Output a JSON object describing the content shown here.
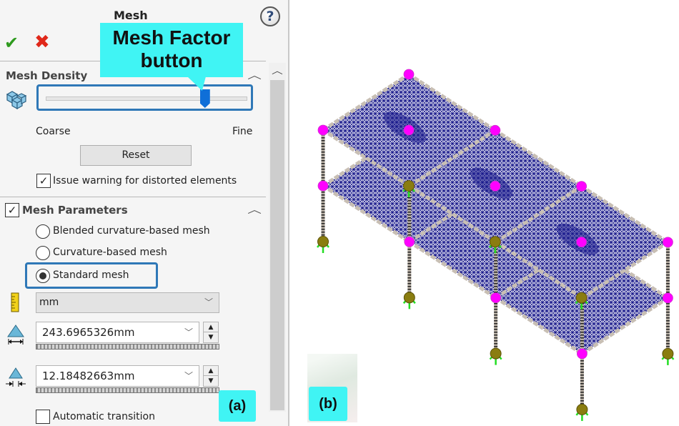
{
  "panel": {
    "title": "Mesh",
    "help_icon": "?",
    "ok_icon": "✔",
    "cancel_icon": "✖",
    "mesh_density": {
      "section_title": "Mesh Density",
      "slider_value_fraction": 0.79,
      "coarse_label": "Coarse",
      "fine_label": "Fine",
      "reset_label": "Reset",
      "warn_checkbox_label": "Issue warning for distorted elements",
      "warn_checked": true
    },
    "mesh_parameters": {
      "section_title": "Mesh Parameters",
      "enabled": true,
      "options": [
        {
          "label": "Blended curvature-based mesh",
          "selected": false
        },
        {
          "label": "Curvature-based mesh",
          "selected": false
        },
        {
          "label": "Standard mesh",
          "selected": true
        }
      ],
      "unit": "mm",
      "global_size": "243.6965326mm",
      "tolerance": "12.18482663mm",
      "auto_transition_label": "Automatic transition",
      "auto_transition_checked": false
    },
    "chevron": "^"
  },
  "annotations": {
    "callout": "Mesh Factor button",
    "callout_line1": "Mesh Factor",
    "callout_line2": "button",
    "label_a": "(a)",
    "label_b": "(b)"
  },
  "colors": {
    "accent_highlight": "#2f78b7",
    "callout_bg": "#40f4f4",
    "mesh_blue": "#1a1a8c",
    "joint_magenta": "#ff00ff",
    "beam_gray": "#c8bfb4",
    "support_olive": "#8a7d10",
    "fixture_green": "#22dd22"
  }
}
